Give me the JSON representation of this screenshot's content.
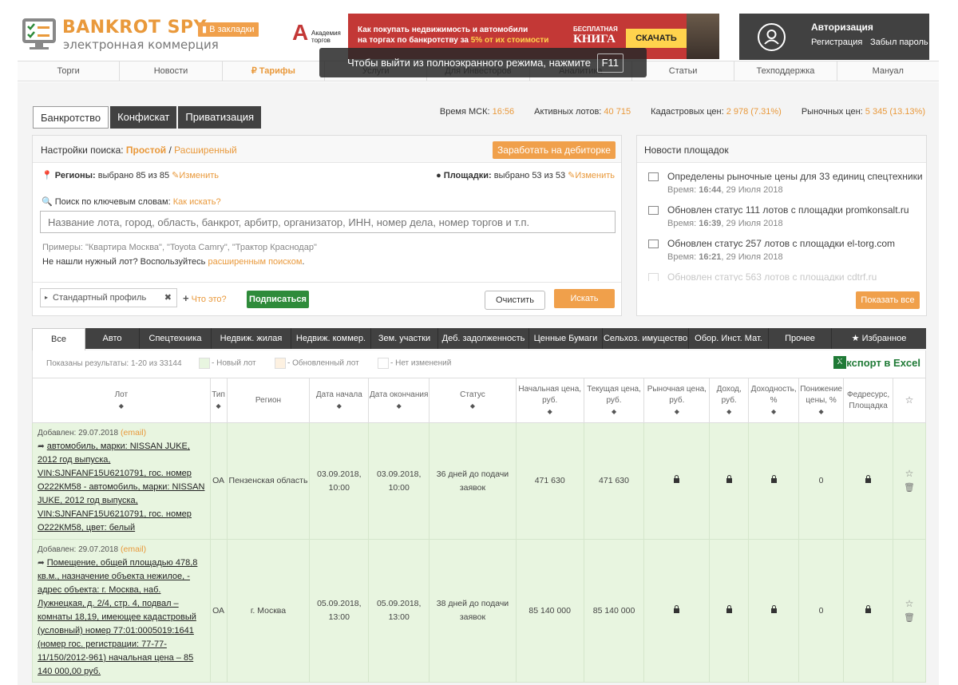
{
  "header": {
    "logo_title": "BANKROT SPY",
    "logo_subtitle": "электронная коммерция",
    "bookmark": "В закладки",
    "banner": {
      "academy": "Академия торгов",
      "line1": "Как покупать недвижимость и автомобили",
      "line2": "на торгах по банкротству за ",
      "highlight": "5% от их стоимости",
      "free": "БЕСПЛАТНАЯ",
      "book": "КНИГА",
      "download": "СКАЧАТЬ"
    },
    "auth": {
      "title": "Авторизация",
      "register": "Регистрация",
      "forgot": "Забыл пароль"
    }
  },
  "nav": [
    "Торги",
    "Новости",
    "₽ Тарифы",
    "Услуги",
    "Для Инвесторов",
    "Аналитика",
    "Статьи",
    "Техподдержка",
    "Мануал"
  ],
  "nav_active": 2,
  "fullscreen": {
    "text": "Чтобы выйти из полноэкранного режима, нажмите",
    "key": "F11"
  },
  "mode_tabs": [
    "Банкротство",
    "Конфискат",
    "Приватизация"
  ],
  "stats": [
    {
      "label": "Время МСК:",
      "value": "16:56"
    },
    {
      "label": "Активных лотов:",
      "value": "40 715"
    },
    {
      "label": "Кадастровых цен:",
      "value": "2 978 (7.31%)"
    },
    {
      "label": "Рыночных цен:",
      "value": "5 345 (13.13%)"
    }
  ],
  "search": {
    "title": "Настройки поиска:",
    "simple": "Простой",
    "advanced": "Расширенный",
    "earn": "Заработать на дебиторке",
    "regions_label": "Регионы:",
    "regions_value": "выбрано 85 из 85",
    "areas_label": "Площадки:",
    "areas_value": "выбрано 53 из 53",
    "change": "Изменить",
    "kw_label": "Поиск по ключевым словам:",
    "kw_how": "Как искать?",
    "placeholder": "Название лота, город, область, банкрот, арбитр, организатор, ИНН, номер дела, номер торгов и т.п.",
    "examples": "Примеры: \"Квартира Москва\", \"Toyota Camry\", \"Трактор Краснодар\"",
    "notfound": "Не нашли нужный лот? Воспользуйтесь",
    "notfound_link": "расширенным поиском",
    "profile": "Стандартный профиль",
    "what": "Что это?",
    "subscribe": "Подписаться",
    "clear": "Очистить",
    "search": "Искать"
  },
  "news": {
    "title": "Новости площадок",
    "items": [
      {
        "text": "Определены рыночные цены для 33 единиц спецтехники",
        "time_label": "Время:",
        "time": "16:44",
        "date": ", 29 Июля 2018"
      },
      {
        "text": "Обновлен статус 111 лотов с площадки promkonsalt.ru",
        "time_label": "Время:",
        "time": "16:39",
        "date": ", 29 Июля 2018"
      },
      {
        "text": "Обновлен статус 257 лотов с площадки el-torg.com",
        "time_label": "Время:",
        "time": "16:21",
        "date": ", 29 Июля 2018"
      },
      {
        "text": "Обновлен статус 563 лотов с площадки cdtrf.ru",
        "time_label": "",
        "time": "",
        "date": ""
      }
    ],
    "show_all": "Показать все"
  },
  "categories": [
    "Все",
    "Авто",
    "Спецтехника",
    "Недвиж. жилая",
    "Недвиж. коммер.",
    "Зем. участки",
    "Деб. задолженность",
    "Ценные Бумаги",
    "Сельхоз. имущество",
    "Обор. Инст. Мат.",
    "Прочее",
    "★ Избранное"
  ],
  "results": {
    "shown": "Показаны результаты: 1-20 из 33144",
    "legend_new": "- Новый лот",
    "legend_updated": "- Обновленный лот",
    "legend_nochange": "- Нет изменений",
    "export": "Экспорт в Excel",
    "xls_letter": "X"
  },
  "columns": [
    "Лот",
    "Тип",
    "Регион",
    "Дата начала",
    "Дата окончания",
    "Статус",
    "Начальная цена, руб.",
    "Текущая цена, руб.",
    "Рыночная цена, руб.",
    "Доход, руб.",
    "Доходность, %",
    "Понижение цены, %",
    "Федресурс, Площадка",
    "☆"
  ],
  "rows": [
    {
      "added": "Добавлен: 29.07.2018",
      "email": "(email)",
      "lot": "автомобиль, марки: NISSAN JUKE, 2012 год выпуска, VIN:SJNFANF15U6210791, гос. номер О222КМ58 - автомобиль, марки: NISSAN JUKE, 2012 год выпуска, VIN:SJNFANF15U6210791, гос. номер О222КМ58, цвет: белый",
      "type": "ОА",
      "region": "Пензенская область",
      "start": "03.09.2018, 10:00",
      "end": "03.09.2018, 10:00",
      "status": "36 дней до подачи заявок",
      "start_price": "471 630",
      "current_price": "471 630",
      "decrease": "0"
    },
    {
      "added": "Добавлен: 29.07.2018",
      "email": "(email)",
      "lot": "Помещение, общей площадью 478,8 кв.м., назначение объекта нежилое, - адрес объекта: г. Москва, наб. Лужнецкая, д. 2/4, стр. 4, подвал – комнаты 18,19, имеющее кадастровый (условный) номер 77:01:0005019:1641 (номер гос. регистрации: 77-77-11/150/2012-961) начальная цена – 85 140 000,00 руб.",
      "type": "ОА",
      "region": "г. Москва",
      "start": "05.09.2018, 13:00",
      "end": "05.09.2018, 13:00",
      "status": "38 дней до подачи заявок",
      "start_price": "85 140 000",
      "current_price": "85 140 000",
      "decrease": "0"
    }
  ]
}
